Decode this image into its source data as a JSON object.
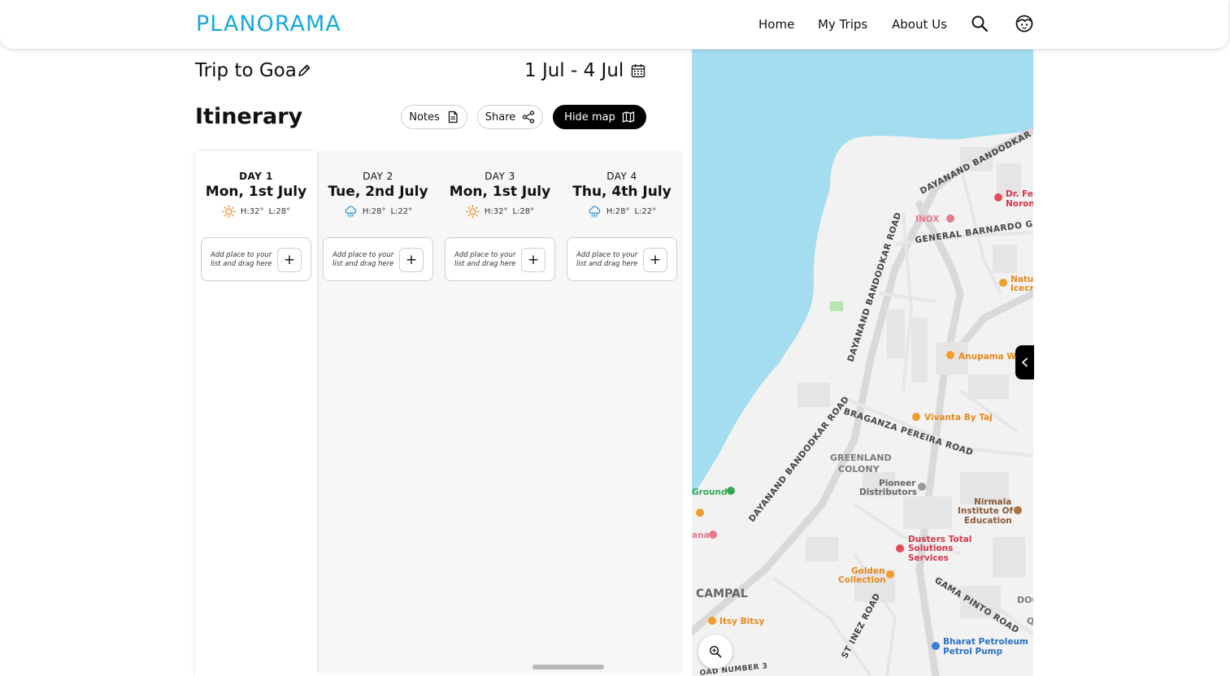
{
  "app": {
    "logo_text": "PLANORAMA",
    "brand_color": "#18a9dc"
  },
  "nav": {
    "home": "Home",
    "my_trips": "My Trips",
    "about_us": "About Us"
  },
  "trip": {
    "title": "Trip to Goa",
    "dates": "1 Jul - 4 Jul"
  },
  "itinerary": {
    "title": "Itinerary",
    "notes_label": "Notes",
    "share_label": "Share",
    "hide_map_label": "Hide map"
  },
  "days": [
    {
      "label": "DAY 1",
      "date": "Mon, 1st July",
      "weather_icon": "sun-icon",
      "high": "H:32°",
      "low": "L:28°",
      "add_text": "Add place to your list and drag here",
      "add_symbol": "+"
    },
    {
      "label": "DAY 2",
      "date": "Tue, 2nd July",
      "weather_icon": "rain-cloud-icon",
      "high": "H:28°",
      "low": "L:22°",
      "add_text": "Add place to your list and drag here",
      "add_symbol": "+"
    },
    {
      "label": "DAY 3",
      "date": "Mon, 1st July",
      "weather_icon": "sun-icon",
      "high": "H:32°",
      "low": "L:28°",
      "add_text": "Add place to your list and drag here",
      "add_symbol": "+"
    },
    {
      "label": "DAY 4",
      "date": "Thu, 4th July",
      "weather_icon": "rain-cloud-icon",
      "high": "H:28°",
      "low": "L:22°",
      "add_text": "Add place to your list and drag here",
      "add_symbol": "+"
    }
  ],
  "map": {
    "water_color": "#a4dcf0",
    "roads": {
      "dayanand_top": "DAYANAND BANDODKAR RO",
      "dayanand_mid": "DAYANAND BANDODKAR ROAD",
      "dayanand_low": "DAYANAND BANDODKAR ROAD",
      "general_barnardo": "GENERAL BARNARDO GU",
      "braganza": "BRAGANZA PEREIRA ROAD",
      "gama_pinto": "GAMA PINTO ROAD",
      "st_inez": "ST INEZ ROAD",
      "road_number": "OAD NUMBER 3"
    },
    "areas": {
      "greenland_1": "GREENLAND",
      "greenland_2": "COLONY",
      "campal": "CAMPAL",
      "doc": "DOC",
      "q": "Q"
    },
    "places": {
      "dr_fe": "Dr. Fe",
      "noron": "Noron",
      "inox": "INOX",
      "natu": "Natu",
      "icecr": "Icecr",
      "anupama": "Anupama W",
      "vivanta": "Vivanta By Taj",
      "pioneer_1": "Pioneer",
      "pioneer_2": "Distributors",
      "nirmala_1": "Nirmala",
      "nirmala_2": "Institute Of",
      "nirmala_3": "Education",
      "dusters_1": "Dusters Total",
      "dusters_2": "Solutions",
      "dusters_3": "Services",
      "golden_1": "Golden",
      "golden_2": "Collection",
      "itsy": "Itsy Bitsy",
      "ground": "Ground",
      "ana": "ana",
      "bharat_1": "Bharat Petroleum",
      "bharat_2": "Petrol Pump"
    }
  }
}
